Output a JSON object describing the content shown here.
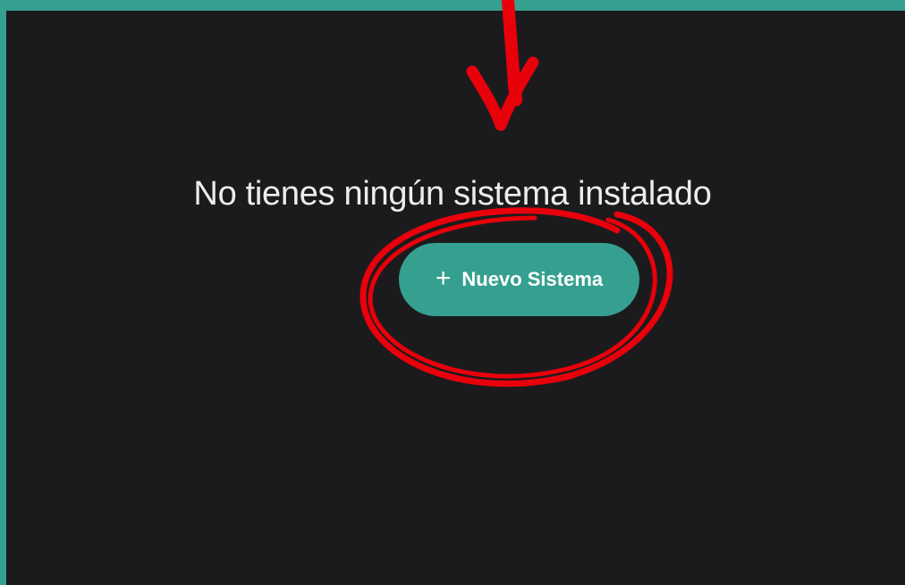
{
  "empty_state": {
    "message": "No tienes ningún sistema instalado",
    "button": {
      "icon": "plus-icon",
      "icon_glyph": "+",
      "label": "Nuevo Sistema"
    }
  },
  "colors": {
    "accent": "#35a08f",
    "background": "#1b1b1d",
    "text": "#ededed",
    "annotation": "#e8000b"
  },
  "annotations": [
    "red-arrow-icon",
    "red-circle-highlight"
  ]
}
